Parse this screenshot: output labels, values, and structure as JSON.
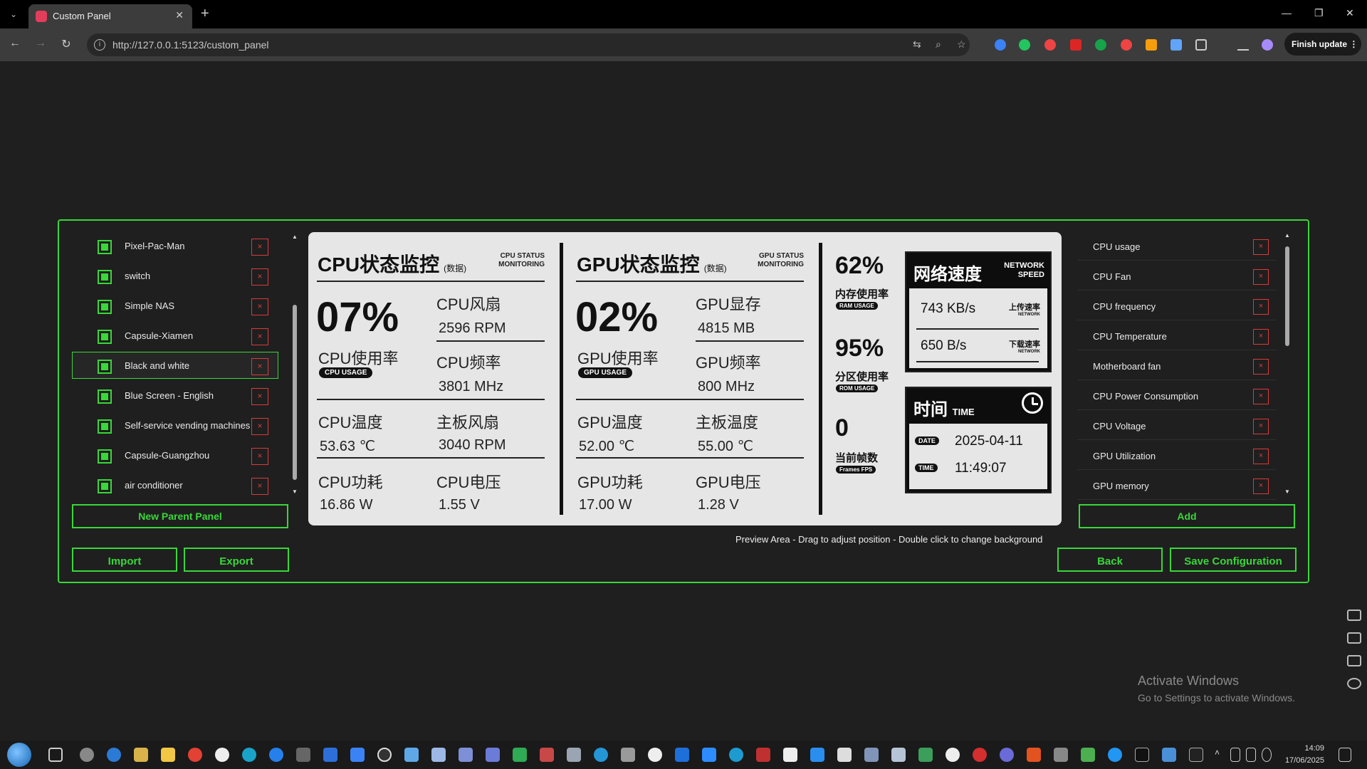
{
  "browser": {
    "tab_title": "Custom Panel",
    "url": "http://127.0.0.1:5123/custom_panel",
    "finish_update": "Finish update"
  },
  "left_panel": {
    "items": [
      {
        "label": "Pixel-Pac-Man",
        "checked": true
      },
      {
        "label": "switch",
        "checked": true
      },
      {
        "label": "Simple NAS",
        "checked": true
      },
      {
        "label": "Capsule-Xiamen",
        "checked": true
      },
      {
        "label": "Black and white",
        "checked": true,
        "selected": true
      },
      {
        "label": "Blue Screen - English",
        "checked": true
      },
      {
        "label": "Self-service vending machines",
        "checked": true
      },
      {
        "label": "Capsule-Guangzhou",
        "checked": true
      },
      {
        "label": "air conditioner",
        "checked": true
      }
    ],
    "delete_symbol": "×",
    "new_parent_label": "New Parent Panel",
    "import_label": "Import",
    "export_label": "Export"
  },
  "preview": {
    "caption": "Preview Area - Drag to adjust position - Double click to change background",
    "cpu": {
      "title": "CPU状态监控",
      "title_sub": "(数据)",
      "title_en_1": "CPU STATUS",
      "title_en_2": "MONITORING",
      "usage_pct": "07%",
      "usage_cn": "CPU使用率",
      "usage_pill": "CPU USAGE",
      "fan_cn": "CPU风扇",
      "fan_val": "2596 RPM",
      "freq_cn": "CPU频率",
      "freq_val": "3801 MHz",
      "temp_cn": "CPU温度",
      "temp_val": "53.63 ℃",
      "mb_fan_cn": "主板风扇",
      "mb_fan_val": "3040 RPM",
      "power_cn": "CPU功耗",
      "power_val": "16.86 W",
      "volt_cn": "CPU电压",
      "volt_val": "1.55 V"
    },
    "gpu": {
      "title": "GPU状态监控",
      "title_sub": "(数据)",
      "title_en_1": "GPU STATUS",
      "title_en_2": "MONITORING",
      "usage_pct": "02%",
      "usage_cn": "GPU使用率",
      "usage_pill": "GPU USAGE",
      "mem_cn": "GPU显存",
      "mem_val": "4815 MB",
      "freq_cn": "GPU频率",
      "freq_val": "800 MHz",
      "temp_cn": "GPU温度",
      "temp_val": "52.00 ℃",
      "mb_temp_cn": "主板温度",
      "mb_temp_val": "55.00 ℃",
      "power_cn": "GPU功耗",
      "power_val": "17.00 W",
      "volt_cn": "GPU电压",
      "volt_val": "1.28 V"
    },
    "stats": {
      "ram_pct": "62%",
      "ram_cn": "内存使用率",
      "ram_pill": "RAM USAGE",
      "rom_pct": "95%",
      "rom_cn": "分区使用率",
      "rom_pill": "ROM USAGE",
      "fps": "0",
      "fps_cn": "当前帧数",
      "fps_pill": "Frames FPS"
    },
    "network": {
      "title_cn": "网络速度",
      "title_en_1": "NETWORK",
      "title_en_2": "SPEED",
      "up_val": "743 KB/s",
      "up_cn": "上传速率",
      "up_en": "NETWORK",
      "down_val": "650 B/s",
      "down_cn": "下载速率",
      "down_en": "NETWORK"
    },
    "time": {
      "title_cn": "时间",
      "title_en": "TIME",
      "date_pill": "DATE",
      "date_val": "2025-04-11",
      "time_pill": "TIME",
      "time_val": "11:49:07"
    }
  },
  "right_panel": {
    "items": [
      "CPU usage",
      "CPU Fan",
      "CPU frequency",
      "CPU Temperature",
      "Motherboard fan",
      "CPU Power Consumption",
      "CPU Voltage",
      "GPU Utilization",
      "GPU memory"
    ],
    "delete_symbol": "×",
    "add_label": "Add",
    "back_label": "Back",
    "save_label": "Save Configuration"
  },
  "watermark": {
    "line1": "Activate Windows",
    "line2": "Go to Settings to activate Windows."
  },
  "taskbar": {
    "time": "14:09",
    "date": "17/06/2025"
  },
  "colors": {
    "accent_green": "#39d739",
    "delete_red": "#d83b3b",
    "background": "#1f1f1f"
  }
}
